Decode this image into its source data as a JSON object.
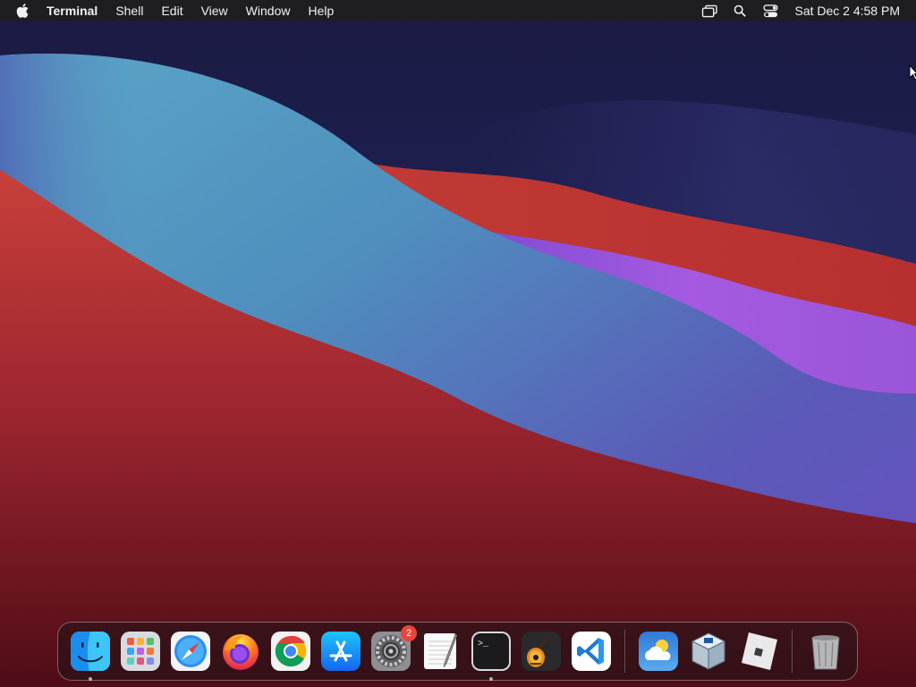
{
  "menubar": {
    "app_name": "Terminal",
    "menus": [
      "Shell",
      "Edit",
      "View",
      "Window",
      "Help"
    ],
    "status_icons": [
      "screen-mirroring-icon",
      "search-icon",
      "control-center-icon"
    ],
    "clock": "Sat Dec 2  4:58 PM"
  },
  "dock": {
    "apps": [
      {
        "icon": "finder-icon",
        "running": true
      },
      {
        "icon": "launchpad-icon",
        "running": false
      },
      {
        "icon": "safari-icon",
        "running": false
      },
      {
        "icon": "firefox-icon",
        "running": false
      },
      {
        "icon": "chrome-icon",
        "running": false
      },
      {
        "icon": "app-store-icon",
        "running": false
      },
      {
        "icon": "system-preferences-icon",
        "running": false,
        "badge": "2"
      },
      {
        "icon": "textedit-icon",
        "running": false
      },
      {
        "icon": "terminal-icon",
        "running": true
      },
      {
        "icon": "garageband-icon",
        "running": false
      },
      {
        "icon": "vscode-icon",
        "running": false
      },
      {
        "icon": "weather-icon",
        "running": false
      },
      {
        "icon": "virtualbox-icon",
        "running": false
      },
      {
        "icon": "roblox-icon",
        "running": false
      },
      {
        "icon": "trash-icon",
        "running": false
      }
    ]
  },
  "colors": {
    "menubar_bg": "#1e1e22",
    "badge": "#e5463a",
    "wallpaper_red": "#c23a34",
    "wallpaper_blue": "#4f8fbe",
    "wallpaper_purple": "#9a55d8",
    "wallpaper_navy": "#1c1c48"
  }
}
